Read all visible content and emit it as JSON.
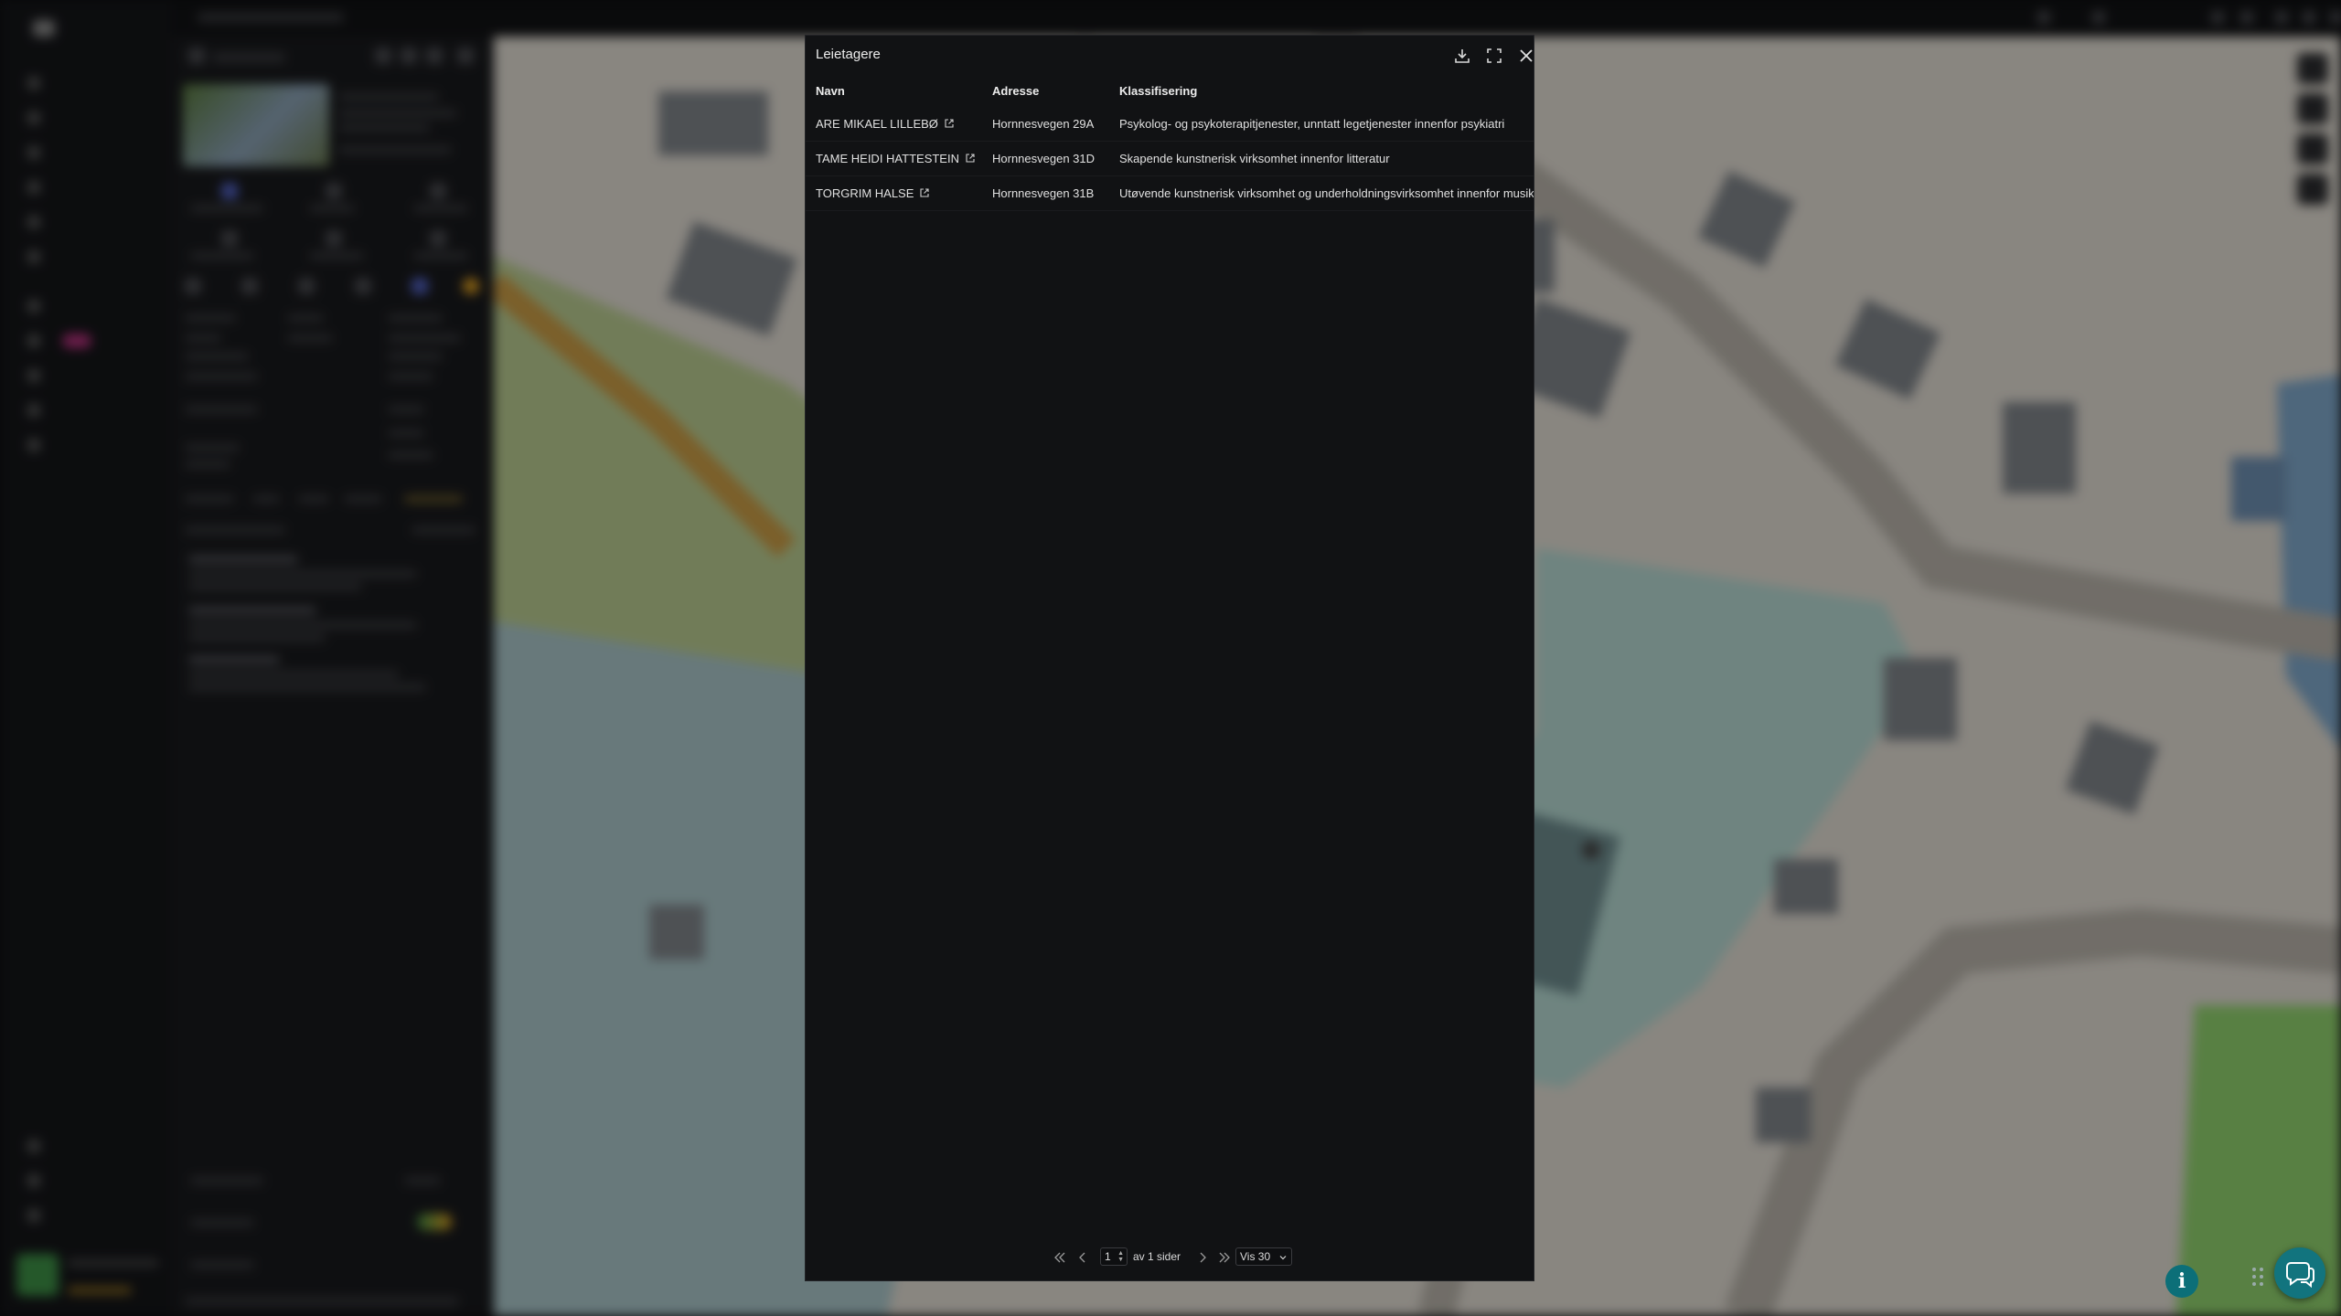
{
  "modal": {
    "title": "Leietagere",
    "columns": [
      "Navn",
      "Adresse",
      "Klassifisering"
    ],
    "rows": [
      {
        "name": "ARE MIKAEL LILLEBØ",
        "address": "Hornnesvegen 29A",
        "classification": "Psykolog- og psykoterapitjenester, unntatt legetjenester innenfor psykiatri"
      },
      {
        "name": "TAME HEIDI HATTESTEIN",
        "address": "Hornnesvegen 31D",
        "classification": "Skapende kunstnerisk virksomhet innenfor litteratur"
      },
      {
        "name": "TORGRIM HALSE",
        "address": "Hornnesvegen 31B",
        "classification": "Utøvende kunstnerisk virksomhet og underholdningsvirksomhet innenfor musikk"
      }
    ],
    "actions": {
      "download_icon": "download-icon",
      "expand_icon": "expand-icon",
      "close_icon": "close-icon"
    },
    "pagination": {
      "current_page": "1",
      "of_text": "av 1 sider",
      "page_size": "Vis 30"
    }
  },
  "colors": {
    "modal_bg": "#111214",
    "accent_teal": "#12747e",
    "map_land": "#ddd8cf",
    "map_water": "#a8c4c7",
    "map_green": "#b7c98f"
  },
  "floating": {
    "info_label": "i",
    "info_icon": "info-icon",
    "chat_icon": "chat-icon"
  }
}
